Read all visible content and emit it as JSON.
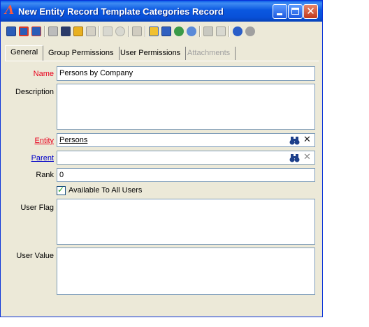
{
  "window": {
    "title": "New Entity Record Template Categories Record",
    "app_icon_glyph": "Λ",
    "close_glyph": "✕"
  },
  "toolbar": {
    "icons": [
      "save-icon",
      "save-new-icon",
      "save-close-icon",
      "print-icon",
      "find-icon",
      "open-folder-icon",
      "properties-icon",
      "forward-icon",
      "refresh-icon",
      "link-icon",
      "copy-icon",
      "copy-record-icon",
      "web-icon",
      "settings-icon",
      "attach-icon",
      "tag-icon",
      "help-icon",
      "info-icon"
    ]
  },
  "tabs": [
    {
      "label": "General",
      "active": true
    },
    {
      "label": "Group Permissions",
      "active": false
    },
    {
      "label": "User Permissions",
      "active": false
    },
    {
      "label": "Attachments",
      "active": false,
      "disabled": true
    }
  ],
  "form": {
    "name_label": "Name",
    "name_value": "Persons by Company",
    "description_label": "Description",
    "description_value": "",
    "entity_label": "Entity",
    "entity_value": "Persons",
    "parent_label": "Parent",
    "parent_value": "",
    "rank_label": "Rank",
    "rank_value": "0",
    "available_label": "Available To All Users",
    "available_checked": true,
    "check_glyph": "✓",
    "clear_glyph": "✕",
    "user_flag_label": "User Flag",
    "user_flag_value": "",
    "user_value_label": "User Value",
    "user_value_value": ""
  },
  "colors": {
    "required_label": "#e8001c",
    "link_label": "#0000c8",
    "titlebar": "#0a57e0"
  }
}
